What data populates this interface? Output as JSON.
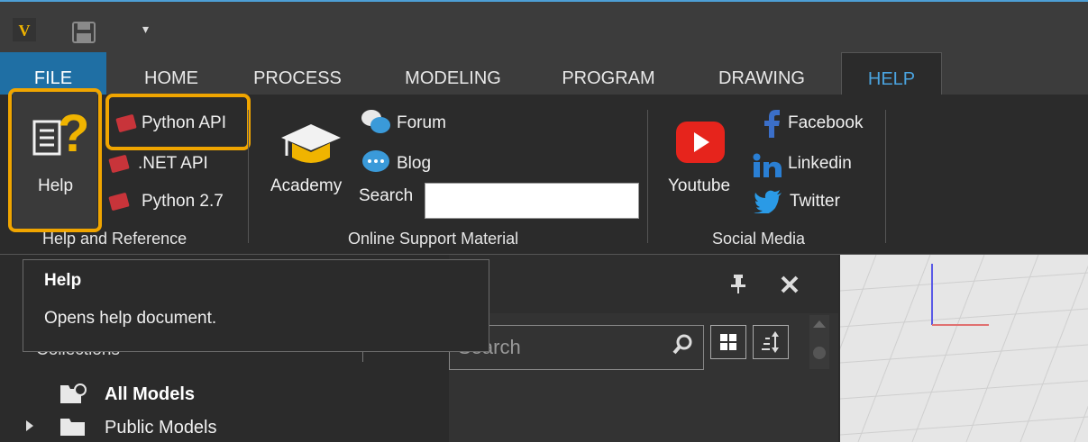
{
  "quick_access": {
    "menu_glyph": "▾",
    "logo_letter": "V"
  },
  "tabs": [
    {
      "label": "FILE"
    },
    {
      "label": "HOME"
    },
    {
      "label": "PROCESS"
    },
    {
      "label": "MODELING"
    },
    {
      "label": "PROGRAM"
    },
    {
      "label": "DRAWING"
    },
    {
      "label": "HELP"
    }
  ],
  "ribbon": {
    "help_group": {
      "help_button": "Help",
      "python_api": "Python API",
      "net_api": ".NET API",
      "python27": "Python 2.7",
      "label": "Help and Reference"
    },
    "support_group": {
      "academy": "Academy",
      "forum": "Forum",
      "blog": "Blog",
      "search_label": "Search",
      "search_value": "",
      "label": "Online Support Material"
    },
    "social_group": {
      "youtube": "Youtube",
      "facebook": "Facebook",
      "linkedin": "Linkedin",
      "twitter": "Twitter",
      "label": "Social Media"
    }
  },
  "tooltip": {
    "title": "Help",
    "description": "Opens help document."
  },
  "left_panel": {
    "collections_label": "Collections",
    "all_models": "All Models",
    "public_models": "Public Models"
  },
  "mid_panel": {
    "search_placeholder": "Search"
  },
  "colors": {
    "accent": "#1f6fa4",
    "highlight": "#f0a500",
    "help_tab": "#4aa3df"
  }
}
